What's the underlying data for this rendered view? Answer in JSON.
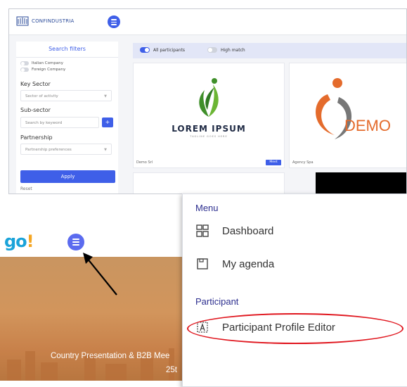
{
  "top_screenshot": {
    "header": {
      "logo_text": "CONFINDUSTRIA"
    },
    "sidebar": {
      "title": "Search filters",
      "company_toggles": [
        {
          "label": "Italian Company"
        },
        {
          "label": "Foreign Company"
        }
      ],
      "key_sector": {
        "label": "Key Sector",
        "placeholder": "Sector of activity"
      },
      "sub_sector": {
        "label": "Sub-sector",
        "placeholder": "Search by keyword",
        "add_symbol": "+"
      },
      "partnership": {
        "label": "Partnership",
        "placeholder": "Partnership preferences"
      },
      "apply_label": "Apply",
      "reset_label": "Reset"
    },
    "filterbar": {
      "all_participants": "All participants",
      "high_match": "High match"
    },
    "cards": [
      {
        "brand_text": "LOREM IPSUM",
        "tagline": "TAGLINE GOES HERE",
        "name": "Demo Srl",
        "button": "Meet"
      },
      {
        "brand_text": "DEMO",
        "name": "Agency Spa"
      }
    ]
  },
  "bottom_screenshot": {
    "logo_main": "go",
    "logo_bang": "!",
    "banner_line1": "Country Presentation & B2B Mee",
    "banner_line2": "25t"
  },
  "menu": {
    "section_menu": "Menu",
    "dashboard": "Dashboard",
    "my_agenda": "My agenda",
    "section_participant": "Participant",
    "profile_editor": "Participant Profile Editor"
  },
  "colors": {
    "accent": "#3f5fe8",
    "menu_section": "#2d2f8f",
    "highlight": "#e0161e",
    "banner": "#c98a52"
  }
}
